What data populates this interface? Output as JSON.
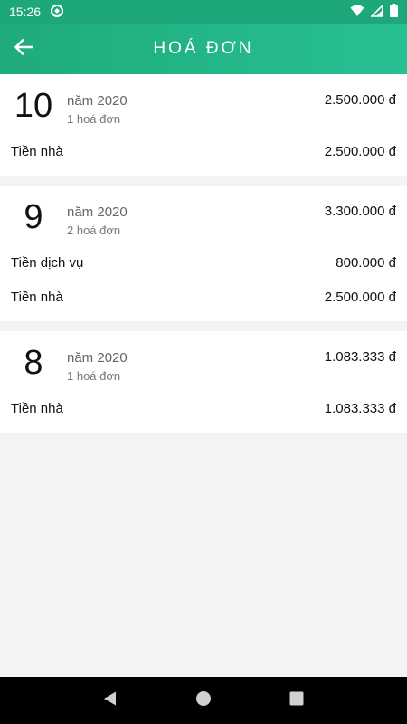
{
  "status_bar": {
    "time": "15:26"
  },
  "app_bar": {
    "title": "HOÁ ĐƠN"
  },
  "invoices": [
    {
      "month": "10",
      "year": "năm 2020",
      "count": "1 hoá đơn",
      "total": "2.500.000 đ",
      "items": [
        {
          "label": "Tiền nhà",
          "amount": "2.500.000 đ"
        }
      ]
    },
    {
      "month": "9",
      "year": "năm 2020",
      "count": "2 hoá đơn",
      "total": "3.300.000 đ",
      "items": [
        {
          "label": "Tiền dịch vụ",
          "amount": "800.000 đ"
        },
        {
          "label": "Tiền nhà",
          "amount": "2.500.000 đ"
        }
      ]
    },
    {
      "month": "8",
      "year": "năm 2020",
      "count": "1 hoá đơn",
      "total": "1.083.333 đ",
      "items": [
        {
          "label": "Tiền nhà",
          "amount": "1.083.333 đ"
        }
      ]
    }
  ],
  "colors": {
    "accent_start": "#1fab7b",
    "accent_end": "#27c093",
    "background": "#f2f3f5"
  },
  "icons": {
    "back": "arrow-left-icon",
    "wifi": "wifi-icon",
    "signal": "signal-icon",
    "battery": "battery-icon",
    "sync": "sync-icon"
  }
}
